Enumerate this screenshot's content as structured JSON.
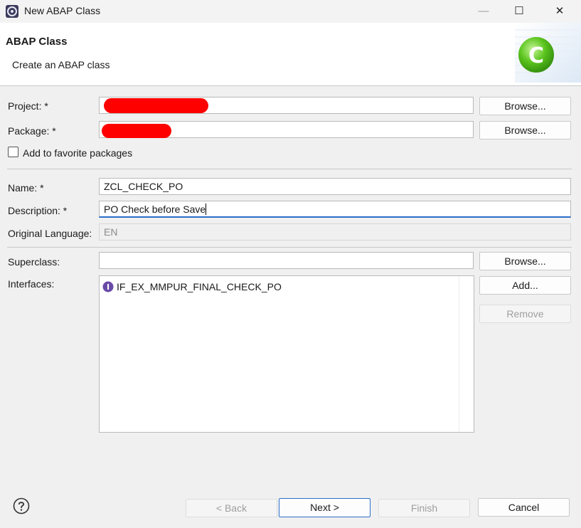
{
  "window": {
    "title": "New ABAP Class",
    "minimize_glyph": "—",
    "maximize_glyph": "☐",
    "close_glyph": "✕"
  },
  "banner": {
    "title": "ABAP Class",
    "subtitle": "Create an ABAP class",
    "logo_letter": "C"
  },
  "form": {
    "project_label": "Project: *",
    "project_value": "",
    "package_label": "Package: *",
    "package_value": "",
    "favorite_label": "Add to favorite packages",
    "favorite_checked": false,
    "name_label": "Name: *",
    "name_value": "ZCL_CHECK_PO",
    "description_label": "Description: *",
    "description_value": "PO Check before Save",
    "language_label": "Original Language:",
    "language_value": "EN",
    "superclass_label": "Superclass:",
    "superclass_value": "",
    "interfaces_label": "Interfaces:",
    "interfaces": [
      "IF_EX_MMPUR_FINAL_CHECK_PO"
    ],
    "interface_icon_letter": "I"
  },
  "buttons": {
    "browse": "Browse...",
    "add": "Add...",
    "remove": "Remove",
    "back": "< Back",
    "next": "Next >",
    "finish": "Finish",
    "cancel": "Cancel"
  },
  "colors": {
    "accent": "#2a6fc9",
    "redaction": "#ff0000",
    "logo_green": "#5cc51e"
  }
}
